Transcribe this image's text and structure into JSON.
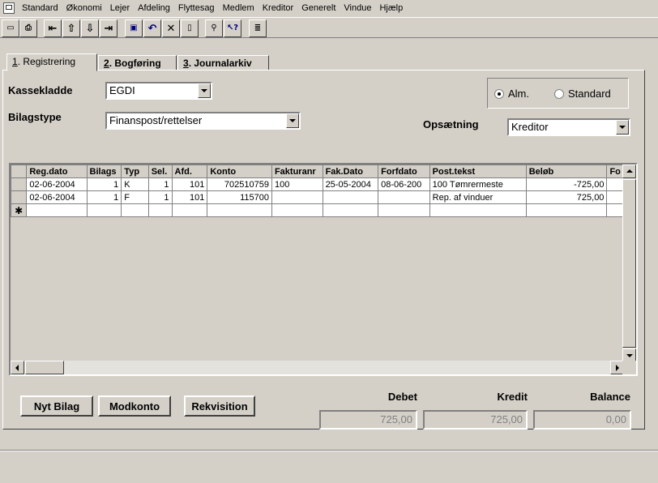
{
  "menu": [
    "Standard",
    "Økonomi",
    "Lejer",
    "Afdeling",
    "Flyttesag",
    "Medlem",
    "Kreditor",
    "Generelt",
    "Vindue",
    "Hjælp"
  ],
  "tabs": [
    {
      "num": "1",
      "label": ". Registrering"
    },
    {
      "num": "2",
      "label": ". Bogføring"
    },
    {
      "num": "3",
      "label": ". Journalarkiv"
    }
  ],
  "form": {
    "kassekladde_label": "Kassekladde",
    "kassekladde_value": "EGDI",
    "bilagstype_label": "Bilagstype",
    "bilagstype_value": "Finanspost/rettelser",
    "opsaetning_label": "Opsætning",
    "opsaetning_value": "Kreditor",
    "radio_alm": "Alm.",
    "radio_standard": "Standard",
    "radio_selected": "Alm."
  },
  "grid": {
    "columns": [
      "Reg.dato",
      "Bilags",
      "Typ",
      "Sel.",
      "Afd.",
      "Konto",
      "Fakturanr",
      "Fak.Dato",
      "Forfdato",
      "Post.tekst",
      "Beløb",
      "Fo"
    ],
    "rows": [
      [
        "02-06-2004",
        "1",
        "K",
        "1",
        "101",
        "702510759",
        "100",
        "25-05-2004",
        "08-06-200",
        "100  Tømrermeste",
        "-725,00",
        ""
      ],
      [
        "02-06-2004",
        "1",
        "F",
        "1",
        "101",
        "115700",
        "",
        "",
        "",
        "Rep. af vinduer",
        "725,00",
        ""
      ]
    ],
    "new_row_marker": "✱"
  },
  "buttons": {
    "nyt_bilag": "Nyt Bilag",
    "modkonto": "Modkonto",
    "rekvisition": "Rekvisition"
  },
  "totals": {
    "debet_label": "Debet",
    "debet_value": "725,00",
    "kredit_label": "Kredit",
    "kredit_value": "725,00",
    "balance_label": "Balance",
    "balance_value": "0,00"
  },
  "toolbar_icons": [
    "new-icon",
    "print-icon",
    "first-record-icon",
    "prev-record-icon",
    "next-record-icon",
    "last-record-icon",
    "save-icon",
    "undo-icon",
    "delete-icon",
    "new-document-icon",
    "find-icon",
    "help-icon",
    "report-icon"
  ]
}
